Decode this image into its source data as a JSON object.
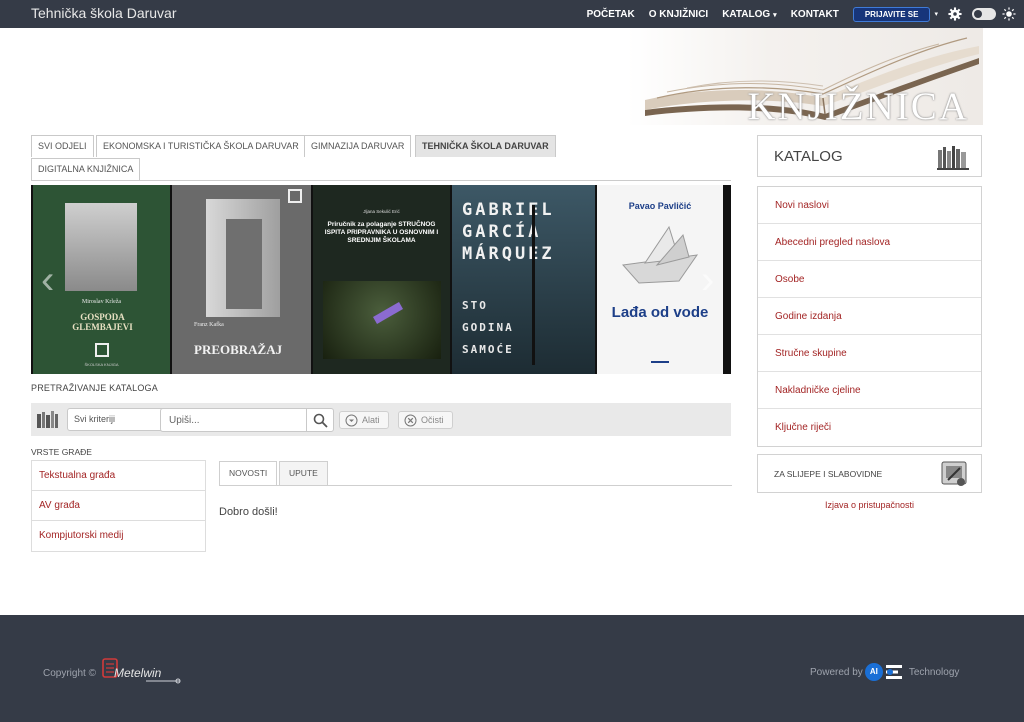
{
  "header": {
    "site_title": "Tehnička škola Daruvar",
    "nav": [
      {
        "label": "POČETAK"
      },
      {
        "label": "O KNJIŽNICI"
      },
      {
        "label": "KATALOG",
        "caret": "▾"
      },
      {
        "label": "KONTAKT"
      }
    ],
    "login_label": "PRIJAVITE SE",
    "login_caret": "▾"
  },
  "banner": {
    "title": "KNJIŽNICA"
  },
  "tabs": [
    {
      "label": "SVI ODJELI"
    },
    {
      "label": "EKONOMSKA I TURISTIČKA ŠKOLA DARUVAR"
    },
    {
      "label": "GIMNAZIJA DARUVAR"
    },
    {
      "label": "TEHNIČKA ŠKOLA DARUVAR",
      "active": true
    },
    {
      "label": "DIGITALNA KNJIŽNICA"
    }
  ],
  "carousel": {
    "prev": "‹",
    "next": "›",
    "books": [
      {
        "author": "Miroslav Krleža",
        "title": "GOSPODA GLEMBAJEVI",
        "publisher": "ŠKOLSKA KNJIGA",
        "color": "#3b5a3f"
      },
      {
        "author": "Franz Kafka",
        "title": "PREOBRAŽAJ",
        "color": "#5a5a5a"
      },
      {
        "author": "Jljana Sekulić Erić",
        "title": "Priručnik za polaganje STRUČNOG ISPITA PRIPRAVNIKA U OSNOVNIM I SREDNJIM ŠKOLAMA",
        "color": "#1f2a22"
      },
      {
        "author": "GABRIEL GARCÍA MÁRQUEZ",
        "title": "STO GODINA SAMOĆE",
        "color": "#2a3b44"
      },
      {
        "author": "Pavao Pavličić",
        "title": "Lađa od vode",
        "color": "#f5f5f5"
      }
    ]
  },
  "search": {
    "section_label": "PRETRAŽIVANJE KATALOGA",
    "criteria_value": "Svi kriteriji",
    "criteria_caret": "▾",
    "input_placeholder": "Upiši...",
    "tools_label": "Alati",
    "clear_label": "Očisti"
  },
  "material_types": {
    "label": "VRSTE GRAĐE",
    "items": [
      "Tekstualna građa",
      "AV građa",
      "Kompjutorski medij"
    ]
  },
  "news": {
    "tabs": [
      "NOVOSTI",
      "UPUTE"
    ],
    "welcome": "Dobro došli!"
  },
  "sidebar": {
    "catalog_title": "KATALOG",
    "items": [
      "Novi naslovi",
      "Abecedni pregled naslova",
      "Osobe",
      "Godine izdanja",
      "Stručne skupine",
      "Nakladničke cjeline",
      "Ključne riječi"
    ],
    "blind_label": "ZA SLIJEPE I SLABOVIDNE",
    "accessibility_link": "Izjava o pristupačnosti"
  },
  "footer": {
    "copyright": "Copyright ©",
    "metel_logo": "Metelwin",
    "powered_by": "Powered by",
    "ai_badge": "AI",
    "technology": "Technology"
  },
  "colors": {
    "navbar_bg": "#353b47",
    "link_red": "#a32525",
    "login_blue": "#17357a"
  }
}
